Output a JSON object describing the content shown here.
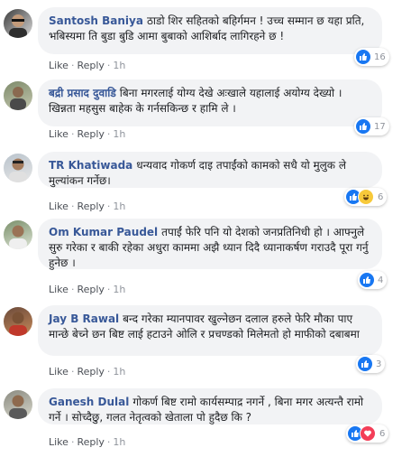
{
  "actions": {
    "like": "Like",
    "reply": "Reply",
    "sep": "·"
  },
  "comments": [
    {
      "author": "Santosh Baniya",
      "text": "ठाडो शिर सहितको बहिर्गमन ! उच्च सम्मान छ यहा प्रति, भबिस्यमा ति बुडा बुडि आमा बुबाको आशिर्बाद लागिरहने छ !",
      "time": "1h",
      "reactions": [
        "like-icon"
      ],
      "count": "16"
    },
    {
      "author": "बद्री प्रसाद दुवाडि",
      "text": "बिना मगरलाई योग्य देखे अःखाले यहालाई अयोग्य देख्यो । खिन्नता महसुस बाहेक के गर्नसकिन्छ र हामि ले ।",
      "time": "1h",
      "reactions": [
        "like-icon"
      ],
      "count": "17"
    },
    {
      "author": "TR Khatiwada",
      "text": "धन्यवाद गोकर्ण दाइ तपाईंको कामको सधै यो मुलुक ले मुल्यांकन गर्नेछ।",
      "time": "1h",
      "reactions": [
        "like-icon",
        "haha-icon"
      ],
      "count": "6"
    },
    {
      "author": "Om Kumar Paudel",
      "text": "तपाईं फेरि पनि यो देशको जनप्रतिनिधी हो । आफ्नुले सुरु गरेका र बाकी रहेका अधुरा काममा अझै ध्यान दिदै ध्यानाकर्षण गराउदै पूरा गर्नु हुनेछ ।",
      "time": "1h",
      "reactions": [
        "like-icon"
      ],
      "count": "4"
    },
    {
      "author": "Jay B Rawal",
      "text": "बन्द गरेका म्यानपावर खुल्नेछन दलाल हरुले फेरि मौका पाए मान्छे बेच्ने छन बिष्ट लाई हटाउने ओलि र प्रचण्डको मिलेमतो हो माफीको दबाबमा",
      "time": "1h",
      "reactions": [
        "like-icon"
      ],
      "count": "3"
    },
    {
      "author": "Ganesh Dulal",
      "text": "गोकर्ण बिष्ट रामो कार्यसम्पाद्र नगर्ने , बिना मगर अत्यन्तै रामो गर्ने । सोच्दैछु, गलत नेतृत्वको खेताला पो हुदैछ कि ?",
      "time": "1h",
      "reactions": [
        "like-icon",
        "love-icon"
      ],
      "count": "6"
    }
  ]
}
